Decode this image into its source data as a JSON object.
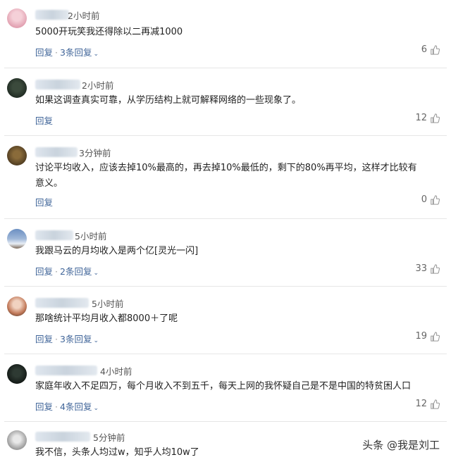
{
  "comments": [
    {
      "time": "2小时前",
      "text": "5000开玩笑我还得除以二再减1000",
      "reply_label": "回复",
      "more_replies": "3条回复",
      "likes": "6"
    },
    {
      "time": "2小时前",
      "text": "如果这调查真实可靠，从学历结构上就可解释网络的一些现象了。",
      "reply_label": "回复",
      "more_replies": "",
      "likes": "12"
    },
    {
      "time": "3分钟前",
      "text": "讨论平均收入，应该去掉10%最高的，再去掉10%最低的，剩下的80%再平均，这样才比较有意义。",
      "reply_label": "回复",
      "more_replies": "",
      "likes": "0"
    },
    {
      "time": "5小时前",
      "text": "我跟马云的月均收入是两个亿[灵光一闪]",
      "reply_label": "回复",
      "more_replies": "2条回复",
      "likes": "33"
    },
    {
      "time": "5小时前",
      "text": "那啥统计平均月收入都8000＋了呢",
      "reply_label": "回复",
      "more_replies": "3条回复",
      "likes": "19"
    },
    {
      "time": "4小时前",
      "text": "家庭年收入不足四万，每个月收入不到五千，每天上网的我怀疑自己是不是中国的特贫困人口",
      "reply_label": "回复",
      "more_replies": "4条回复",
      "likes": "12"
    },
    {
      "time": "5分钟前",
      "text": "我不信，头条人均过w，知乎人均10w了",
      "reply_label": "",
      "more_replies": "",
      "likes": ""
    }
  ],
  "watermark": "头条 @我是刘工",
  "icons": {
    "thumb": "thumbs-up-icon",
    "chevron": "chevron-down-icon"
  }
}
